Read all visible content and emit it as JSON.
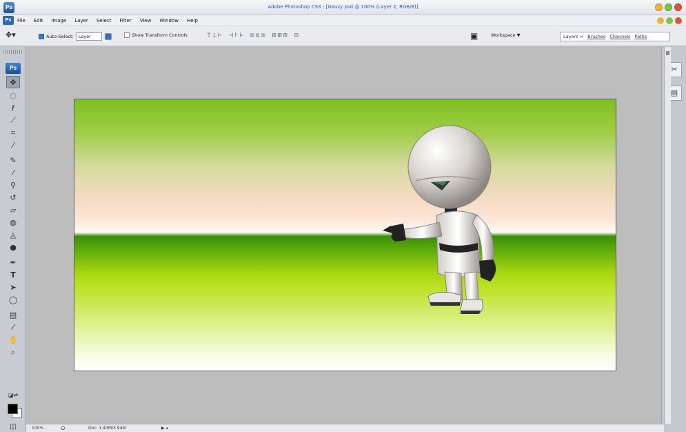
{
  "window": {
    "title": "Adobe Photoshop CS3 - [Gauzy psd @ 100% (Layer 2, RGB/8)]",
    "app_badge": "Ps"
  },
  "menu": [
    "File",
    "Edit",
    "Image",
    "Layer",
    "Select",
    "Filter",
    "View",
    "Window",
    "Help"
  ],
  "options_bar": {
    "auto_select_label": "Auto-Select:",
    "auto_select_checked": true,
    "auto_select_value": "Layer",
    "show_transform_label": "Show Transform Controls",
    "show_transform_checked": false,
    "workspace_label": "Workspace ▼",
    "palette_tabs": [
      "Layers",
      "Brushes",
      "Channels",
      "Paths"
    ]
  },
  "tools": [
    "move-tool",
    "marquee-tool",
    "lasso-tool",
    "magic-wand-tool",
    "crop-tool",
    "slice-tool",
    "healing-brush-tool",
    "brush-tool",
    "clone-stamp-tool",
    "history-brush-tool",
    "eraser-tool",
    "gradient-tool",
    "blur-tool",
    "dodge-tool",
    "pen-tool",
    "type-tool",
    "path-selection-tool",
    "shape-tool",
    "notes-tool",
    "eyedropper-tool",
    "hand-tool",
    "zoom-tool"
  ],
  "colors": {
    "foreground": "#000000",
    "background": "#ffffff",
    "title_text": "#2a55c8"
  },
  "status": {
    "zoom": "100%",
    "doc_info": "Doc: 1.43M/3.94M"
  }
}
